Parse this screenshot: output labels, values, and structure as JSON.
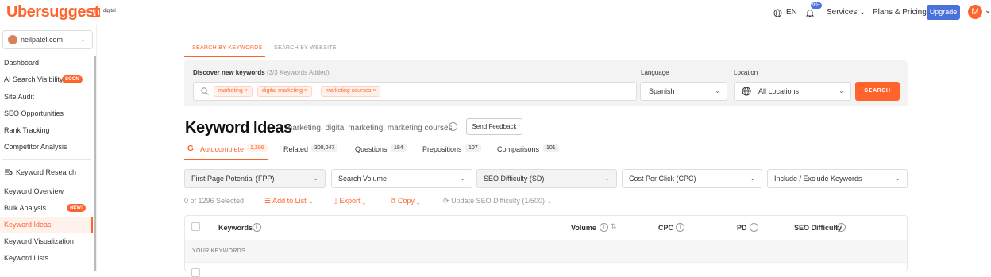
{
  "header": {
    "logo": "Ubersuggest",
    "by": "by",
    "np": "NP",
    "digital": "digital",
    "lang": "EN",
    "notif_count": "99+",
    "services": "Services",
    "plans": "Plans & Pricing",
    "upgrade": "Upgrade",
    "avatar_initial": "M"
  },
  "sidebar": {
    "site": "neilpatel.com",
    "items": [
      {
        "label": "Dashboard"
      },
      {
        "label": "AI Search Visibility",
        "badge": "SOON"
      },
      {
        "label": "Site Audit"
      },
      {
        "label": "SEO Opportunities"
      },
      {
        "label": "Rank Tracking"
      },
      {
        "label": "Competitor Analysis"
      },
      {
        "label": "Keyword Research"
      },
      {
        "label": "Keyword Overview"
      },
      {
        "label": "Bulk Analysis",
        "badge": "NEW!"
      },
      {
        "label": "Keyword Ideas"
      },
      {
        "label": "Keyword Visualization"
      },
      {
        "label": "Keyword Lists"
      }
    ]
  },
  "search": {
    "tab_keywords": "SEARCH BY KEYWORDS",
    "tab_website": "SEARCH BY WEBSITE",
    "discover_label": "Discover new keywords",
    "discover_count": "(3/3 Keywords Added)",
    "chips": [
      "marketing ×",
      "digital marketing ×",
      "marketing courses ×"
    ],
    "language_label": "Language",
    "language_value": "Spanish",
    "location_label": "Location",
    "location_value": "All Locations",
    "button": "SEARCH"
  },
  "ideas": {
    "title": "Keyword Ideas",
    "subtitle": "marketing, digital marketing, marketing courses",
    "feedback": "Send Feedback",
    "tabs": [
      {
        "label": "Autocomplete",
        "count": "1,296"
      },
      {
        "label": "Related",
        "count": "308,047"
      },
      {
        "label": "Questions",
        "count": "184"
      },
      {
        "label": "Prepositions",
        "count": "107"
      },
      {
        "label": "Comparisons",
        "count": "101"
      }
    ],
    "filters": [
      "First Page Potential (FPP)",
      "Search Volume",
      "SEO Difficulty (SD)",
      "Cost Per Click (CPC)",
      "Include / Exclude Keywords"
    ],
    "selected": "0 of 1296 Selected",
    "add_to_list": "Add to List",
    "export": "Export",
    "copy": "Copy",
    "update_sd": "Update SEO Difficulty (1/500)",
    "columns": [
      "Keywords",
      "Volume",
      "CPC",
      "PD",
      "SEO Difficulty"
    ],
    "your_keywords": "YOUR KEYWORDS"
  },
  "colors": {
    "accent": "#ff642d",
    "upgrade": "#4a72d9"
  }
}
